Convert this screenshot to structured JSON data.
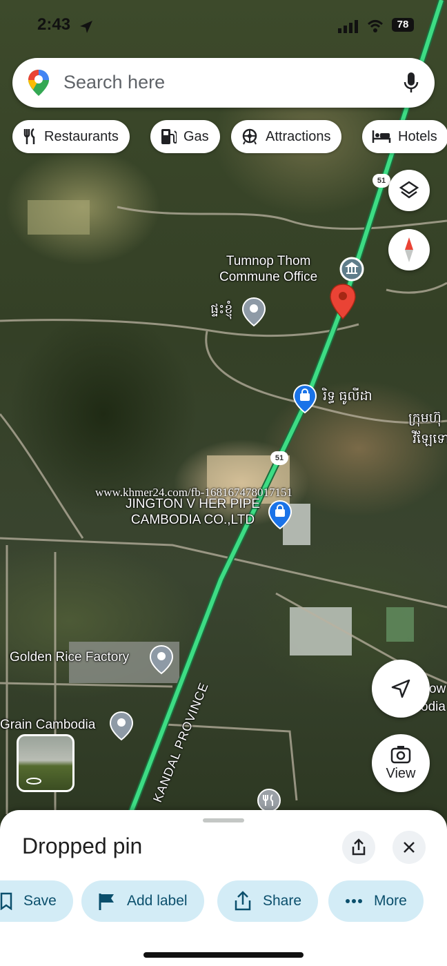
{
  "status_bar": {
    "time": "2:43",
    "battery": "78"
  },
  "search": {
    "placeholder": "Search here"
  },
  "chips": [
    {
      "label": "Restaurants",
      "icon": "restaurant-icon"
    },
    {
      "label": "Gas",
      "icon": "gas-station-icon"
    },
    {
      "label": "Attractions",
      "icon": "attractions-icon"
    },
    {
      "label": "Hotels",
      "icon": "hotel-icon"
    }
  ],
  "map": {
    "labels": {
      "tumnop": "Tumnop Thom\nCommune Office",
      "khmer_place": "ផ្ទះខ្ញុំ",
      "shop": "រិទ្ធ ធូលីដា",
      "khmer_edge1": "ក្រុមហ៊ុ",
      "khmer_edge2": "វីឡែទោព",
      "jington": "JINGTON V HER PIPE\nCAMBODIA CO.,LTD",
      "golden_rice": "Golden Rice Factory",
      "grain": "Grain Cambodia",
      "province": "KANDAL PROVINCE",
      "edge_right1": "ow",
      "edge_right2": "odia"
    },
    "route_number": "51",
    "watermark": "www.khmer24.com/fb-168167478017151",
    "road_color": "#3ddc84",
    "pin_color": "#ea4335"
  },
  "buttons": {
    "view_label": "View"
  },
  "sheet": {
    "title": "Dropped pin",
    "actions": [
      {
        "label": "Save"
      },
      {
        "label": "Add label"
      },
      {
        "label": "Share"
      },
      {
        "label": "More"
      }
    ]
  }
}
